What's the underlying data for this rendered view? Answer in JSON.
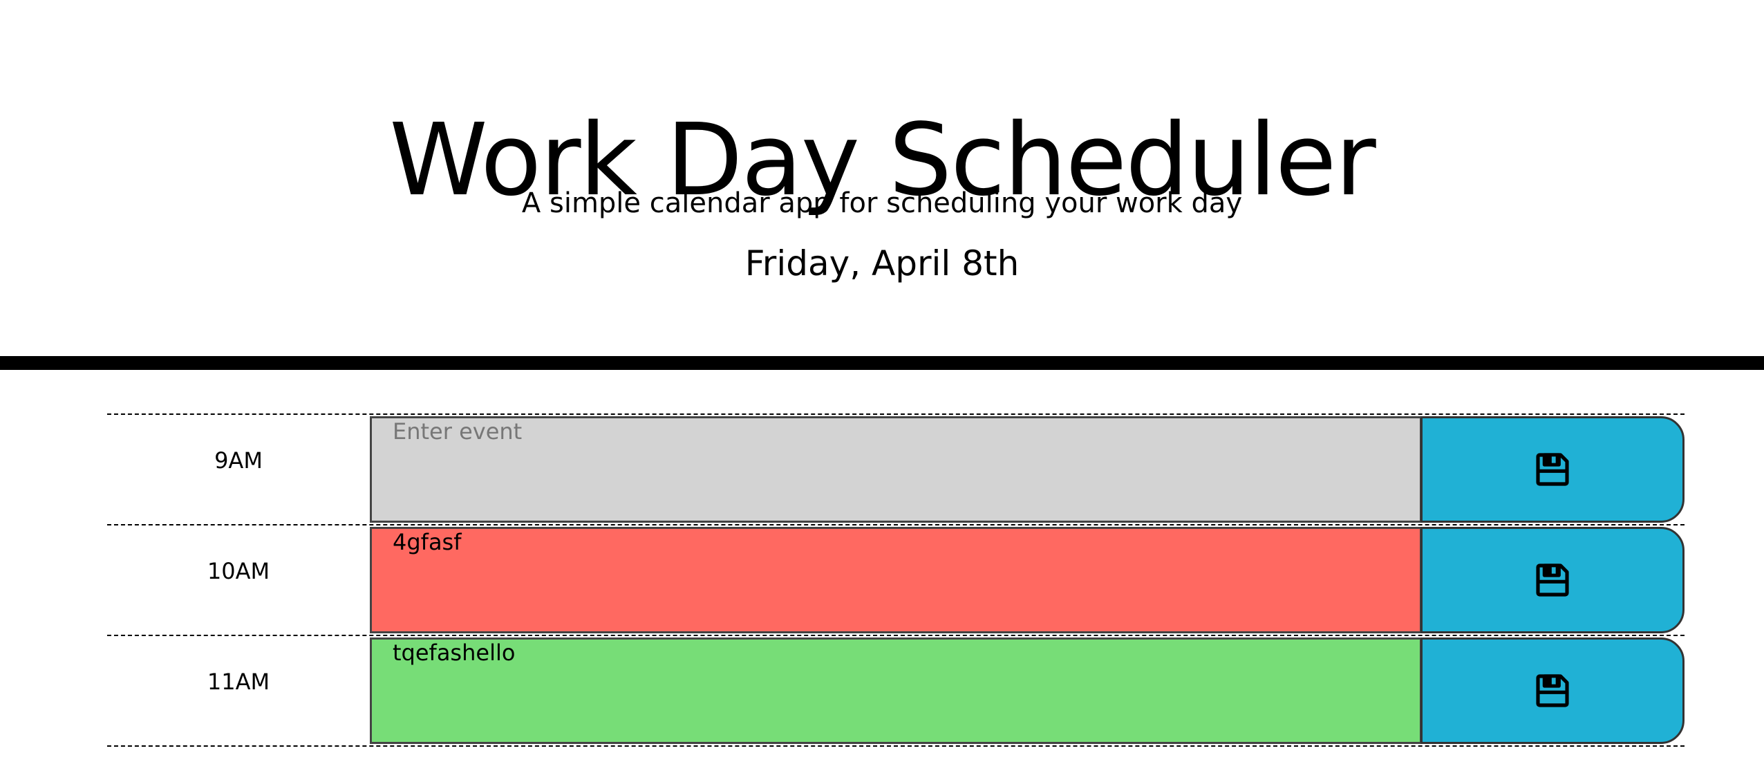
{
  "header": {
    "title": "Work Day Scheduler",
    "subtitle": "A simple calendar app for scheduling your work day",
    "current_day": "Friday, April 8th"
  },
  "icons": {
    "save": "floppy-disk-icon"
  },
  "colors": {
    "past": "#d3d3d3",
    "present": "#ff6961",
    "future": "#77dd77",
    "save_button": "#20b1d5"
  },
  "time_blocks": [
    {
      "hour": "9AM",
      "value": "",
      "placeholder": "Enter event",
      "status": "past"
    },
    {
      "hour": "10AM",
      "value": "4gfasf",
      "placeholder": "Enter event",
      "status": "present"
    },
    {
      "hour": "11AM",
      "value": "tqefashello",
      "placeholder": "Enter event",
      "status": "future"
    }
  ]
}
